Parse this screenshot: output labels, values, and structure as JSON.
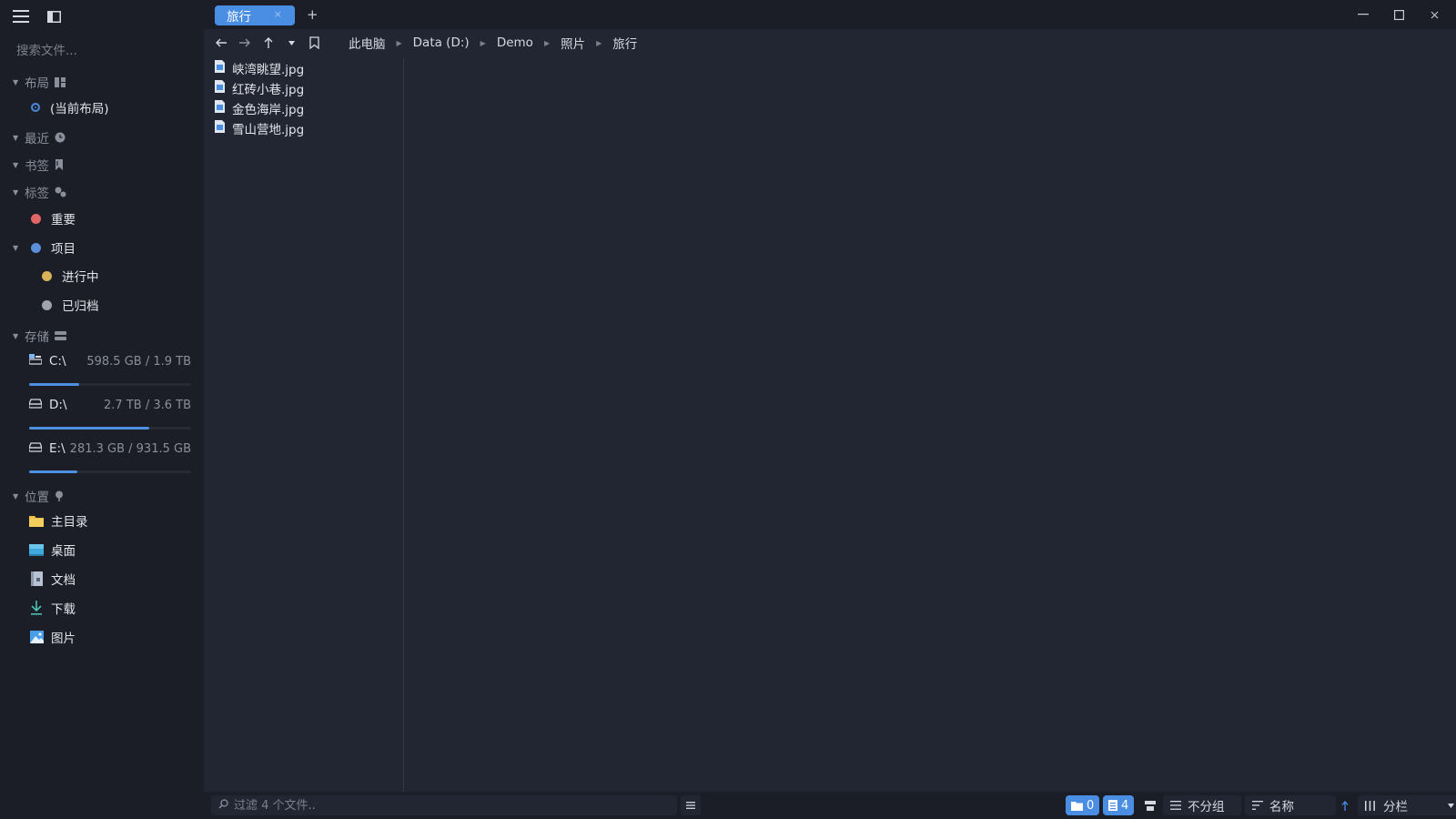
{
  "sidebar": {
    "search_placeholder": "搜索文件...",
    "sections": {
      "layout": "布局",
      "recent": "最近",
      "bookmarks": "书签",
      "tags": "标签",
      "storage": "存储",
      "locations": "位置"
    },
    "layout_item": "(当前布局)",
    "tags": [
      {
        "label": "重要",
        "color": "#e06666"
      },
      {
        "label": "项目",
        "color": "#5b8fd8"
      },
      {
        "label": "进行中",
        "color": "#d9b25a"
      },
      {
        "label": "已归档",
        "color": "#a0a4ac"
      }
    ],
    "drives": [
      {
        "name": "C:\\",
        "size": "598.5 GB / 1.9 TB",
        "usage_fraction": 0.31
      },
      {
        "name": "D:\\",
        "size": "2.7 TB / 3.6 TB",
        "usage_fraction": 0.74
      },
      {
        "name": "E:\\",
        "size": "281.3 GB / 931.5 GB",
        "usage_fraction": 0.3
      }
    ],
    "locations": [
      {
        "label": "主目录",
        "icon": "folder-icon"
      },
      {
        "label": "桌面",
        "icon": "desktop-icon"
      },
      {
        "label": "文档",
        "icon": "document-icon"
      },
      {
        "label": "下载",
        "icon": "download-icon"
      },
      {
        "label": "图片",
        "icon": "picture-icon"
      }
    ]
  },
  "tabs": [
    {
      "label": "旅行",
      "close": "×"
    }
  ],
  "tab_add": "+",
  "breadcrumb": [
    "此电脑",
    "Data (D:)",
    "Demo",
    "照片",
    "旅行"
  ],
  "files": [
    "峡湾眺望.jpg",
    "红砖小巷.jpg",
    "金色海岸.jpg",
    "雪山营地.jpg"
  ],
  "statusbar": {
    "filter_placeholder": "过滤 4 个文件..",
    "folder_count": "0",
    "file_count": "4",
    "group_label": "不分组",
    "sort_label": "名称",
    "view_label": "分栏"
  },
  "colors": {
    "accent": "#4a8ee3",
    "sidebar_bg": "#1b1e27",
    "main_bg": "#222632"
  }
}
